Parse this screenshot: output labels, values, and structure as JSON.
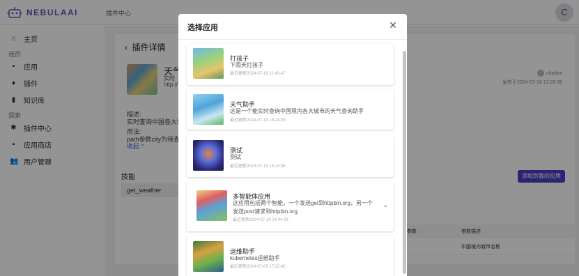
{
  "app": {
    "logo_text": "NEBULAAI",
    "breadcrumb": "插件中心",
    "avatar_letter": "C"
  },
  "sidebar": {
    "items": [
      {
        "label": "主页",
        "icon": "home-icon"
      },
      {
        "section": "我的"
      },
      {
        "label": "应用",
        "icon": "grid-icon"
      },
      {
        "label": "插件",
        "icon": "plug-icon"
      },
      {
        "label": "知识库",
        "icon": "book-icon"
      },
      {
        "section": "探索"
      },
      {
        "label": "插件中心",
        "icon": "puzzle-icon"
      },
      {
        "label": "应用商店",
        "icon": "store-icon"
      },
      {
        "label": "用户管理",
        "icon": "users-icon"
      }
    ]
  },
  "detail": {
    "back_label": "插件详情",
    "plugin_name": "天气",
    "plugin_sub1": "实时",
    "plugin_sub2": "http://",
    "author": "chatbot",
    "published": "发布于2024-07-18 12:28:36",
    "desc_label": "描述:",
    "desc_text": "实时查询中国各大城市",
    "usage_label": "用法:",
    "usage_text": "path参数city为待查询",
    "collapse_label": "收起",
    "skills_label": "技能",
    "skill_item": "get_weather",
    "add_button": "添加到我的应用",
    "table_headers": [
      "参数",
      "参数描述"
    ],
    "table_rows": [
      [
        "",
        "中国境内城市名称"
      ]
    ]
  },
  "modal": {
    "title": "选择应用",
    "apps": [
      {
        "name": "打孩子",
        "desc": "下雨天打孩子",
        "time": "最近更新2024-07-19 11:43:47"
      },
      {
        "name": "天气助手",
        "desc": "这是一个能实时查询中国境内各大城市的天气查询助手",
        "time": "最近更新2024-07-19 18:24:29"
      },
      {
        "name": "测试",
        "desc": "测试",
        "time": "最近更新2024-07-19 15:14:36"
      },
      {
        "name": "多智能体应用",
        "desc": "这应用包括两个智能，一个发送get到httpbin.org，另一个发送post请求到httpbin.org",
        "time": "最近更新2024-07-19 14:44:29"
      },
      {
        "name": "运维助手",
        "desc": "kubernetes运维助手",
        "time": "最近更新2024-07-09 17:22:42"
      }
    ]
  }
}
